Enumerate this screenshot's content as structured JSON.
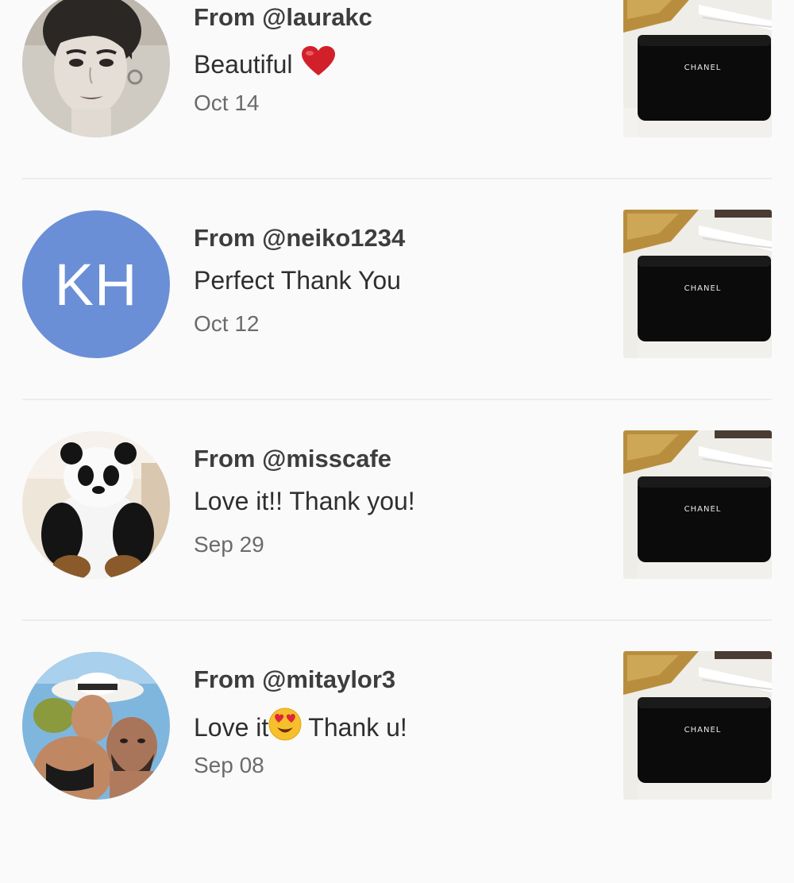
{
  "reviews": [
    {
      "from": "From @laurakc",
      "message": "Beautiful",
      "message_suffix_icon": "red-heart-emoji",
      "date": "Oct 14",
      "avatar_type": "photo-portrait",
      "thumbnail_brand_text": "CHANEL"
    },
    {
      "from": "From @neiko1234",
      "message": "Perfect Thank You",
      "date": "Oct 12",
      "avatar_type": "initials",
      "avatar_initials": "KH",
      "avatar_color": "#6a8fd6",
      "thumbnail_brand_text": "CHANEL"
    },
    {
      "from": "From @misscafe",
      "message": "Love it!! Thank you!",
      "date": "Sep 29",
      "avatar_type": "photo-panda",
      "thumbnail_brand_text": "CHANEL"
    },
    {
      "from": "From @mitaylor3",
      "message_before": "Love it",
      "message_icon": "heart-eyes-emoji",
      "message_after": "Thank u!",
      "date": "Sep 08",
      "avatar_type": "photo-beach",
      "thumbnail_brand_text": "CHANEL"
    }
  ],
  "colors": {
    "background": "#fafafa",
    "divider": "#ececec",
    "initials_avatar": "#6a8fd6",
    "heart": "#d2202a"
  }
}
